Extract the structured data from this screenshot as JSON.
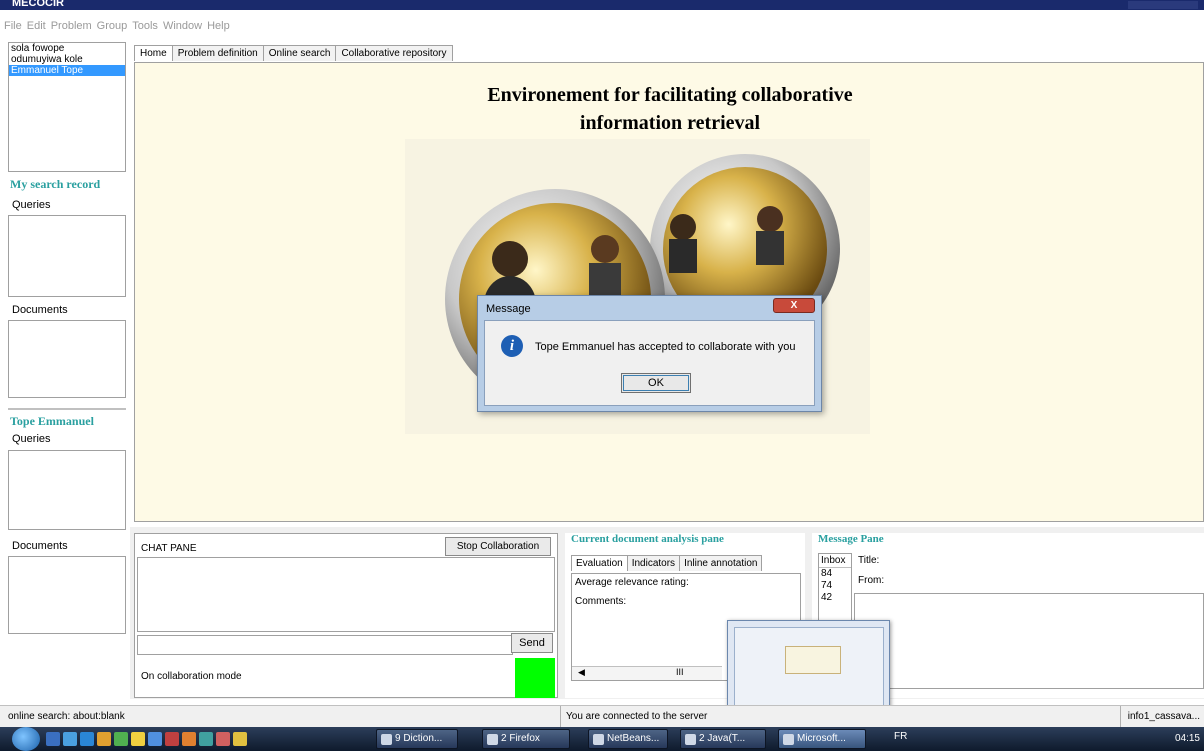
{
  "window": {
    "title": "MECOCIR"
  },
  "menu": [
    "File",
    "Edit",
    "Problem",
    "Group",
    "Tools",
    "Window",
    "Help"
  ],
  "users": [
    {
      "name": "sola fowope",
      "selected": false
    },
    {
      "name": "odumuyiwa kole",
      "selected": false
    },
    {
      "name": "Emmanuel Tope",
      "selected": true
    }
  ],
  "left_panel": {
    "my_search_record": "My search record",
    "queries_label": "Queries",
    "documents_label": "Documents",
    "collaborator_name": "Tope Emmanuel",
    "collab_queries_label": "Queries",
    "collab_documents_label": "Documents"
  },
  "tabs": [
    "Home",
    "Problem definition",
    "Online search",
    "Collaborative repository"
  ],
  "home": {
    "title_line1": "Environement for facilitating collaborative",
    "title_line2": "information retrieval"
  },
  "dialog": {
    "title": "Message",
    "close_label": "X",
    "message": "Tope Emmanuel has accepted to collaborate with you",
    "ok_label": "OK"
  },
  "chat": {
    "header": "CHAT PANE",
    "stop_label": "Stop Collaboration",
    "send_label": "Send",
    "mode_text": "On collaboration mode",
    "indicator_color": "#00ff00"
  },
  "analysis": {
    "title": "Current document analysis pane",
    "tabs": [
      "Evaluation",
      "Indicators",
      "Inline annotation"
    ],
    "avg_label": "Average relevance rating:",
    "comments_label": "Comments:",
    "scroll_glyph": "III"
  },
  "message_pane": {
    "title": "Message Pane",
    "inbox_label": "Inbox",
    "inbox_items": [
      "84",
      "74",
      "42"
    ],
    "title_label": "Title:",
    "from_label": "From:"
  },
  "status": {
    "left": "online search: about:blank",
    "center": "You are connected to the server",
    "right": "info1_cassava..."
  },
  "taskbar": {
    "buttons": [
      "9 Diction...",
      "2 Firefox",
      "NetBeans...",
      "2 Java(T...",
      "Microsoft..."
    ],
    "tray_lang": "FR",
    "clock": "04:15"
  }
}
